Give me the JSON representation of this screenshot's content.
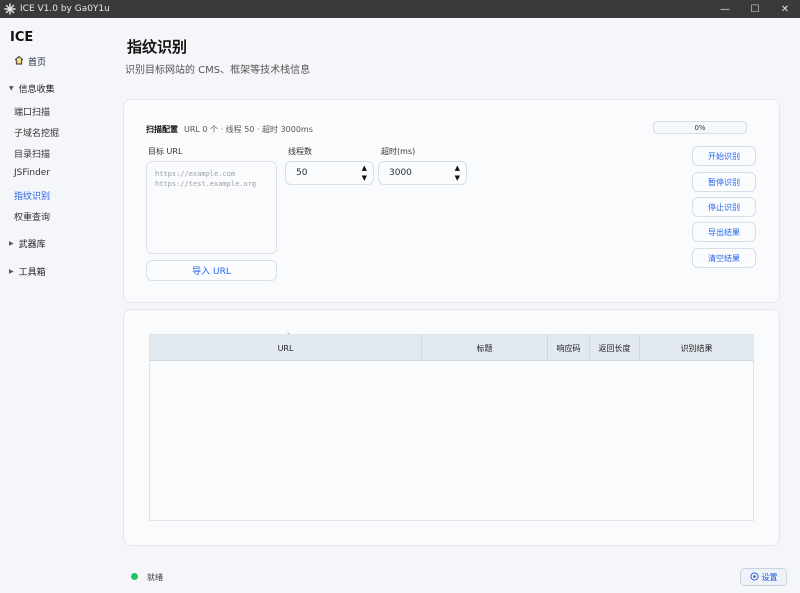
{
  "window": {
    "title": "ICE V1.0 by Ga0Y1u",
    "controls": [
      "—",
      "☐",
      "✕"
    ]
  },
  "sidebar": {
    "brand": "ICE",
    "home": "首页",
    "groups": [
      {
        "label": "信息收集",
        "expanded": true,
        "items": [
          "端口扫描",
          "子域名挖掘",
          "目录扫描",
          "JSFinder",
          "指纹识别",
          "权重查询"
        ]
      },
      {
        "label": "武器库",
        "expanded": false
      },
      {
        "label": "工具箱",
        "expanded": false
      }
    ],
    "active_item": "指纹识别"
  },
  "page": {
    "title": "指纹识别",
    "subtitle": "识别目标网站的 CMS、框架等技术栈信息"
  },
  "config": {
    "heading": "扫描配置",
    "stats": "URL 0 个 · 线程 50 · 超时 3000ms",
    "target_label": "目标 URL",
    "target_placeholder_line1": "https://example.com",
    "target_placeholder_line2": "https://test.example.org",
    "import_label": "导入 URL",
    "threads_label": "线程数",
    "threads_value": "50",
    "timeout_label": "超时(ms)",
    "timeout_value": "3000",
    "progress_text": "0%",
    "progress_value": 0
  },
  "actions": [
    "开始识别",
    "暂停识别",
    "停止识别",
    "导出结果",
    "清空结果"
  ],
  "table": {
    "columns": [
      "URL",
      "标题",
      "响应码",
      "返回长度",
      "识别结果"
    ],
    "rows": []
  },
  "status": {
    "text": "就绪",
    "color": "#22c55e"
  },
  "settings_label": "设置",
  "colors": {
    "accent": "#2563eb",
    "titlebar": "#3a3a3a"
  }
}
